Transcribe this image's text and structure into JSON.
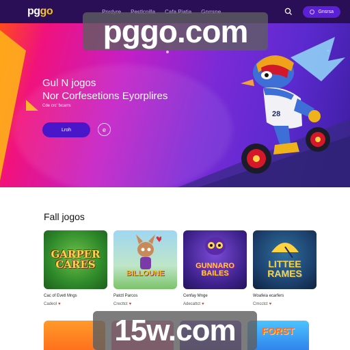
{
  "nav": {
    "logo_main": "pg",
    "logo_accent": "go",
    "links": [
      "Pnrdyre",
      "Pestlcnilla",
      "Cafa Piatia",
      "Gnrrsne"
    ],
    "cta_label": "Gnsrsa"
  },
  "hero": {
    "title_line1": "Gul N jogos",
    "title_line2": "Nor Corfesetions Eyorplires",
    "subtitle": "Cde crc' fxcarrs",
    "button_label": "Lroh",
    "secondary_glyph": "e",
    "mascot_number": "28"
  },
  "watermarks": {
    "top": "pggo.com",
    "bottom": "15w.com"
  },
  "section": {
    "title": "Fall jogos"
  },
  "games": [
    {
      "art_text": "GARPER CARES",
      "title": "Cac of Evetl Mngs",
      "meta": "Cadeol"
    },
    {
      "art_text": "BILLOUNE",
      "title": "Patctl Parcos",
      "meta": "Crecttct"
    },
    {
      "art_text": "GUNNARO BAILES",
      "title": "Cenfay Mnge",
      "meta": "Adecattct"
    },
    {
      "art_text": "LITTEE RAMES",
      "title": "Woafeia ecarfers",
      "meta": "Cmcctct"
    }
  ],
  "games_row2": [
    {
      "art_text": ""
    },
    {
      "art_text": ""
    },
    {
      "art_text": ""
    },
    {
      "art_text": "FORST"
    }
  ],
  "colors": {
    "nav_bg": "#2a0f57",
    "accent": "#5b1fd6",
    "logo_accent": "#f4c21a"
  },
  "icons": {
    "search": "search-icon",
    "like": "heart-icon"
  }
}
